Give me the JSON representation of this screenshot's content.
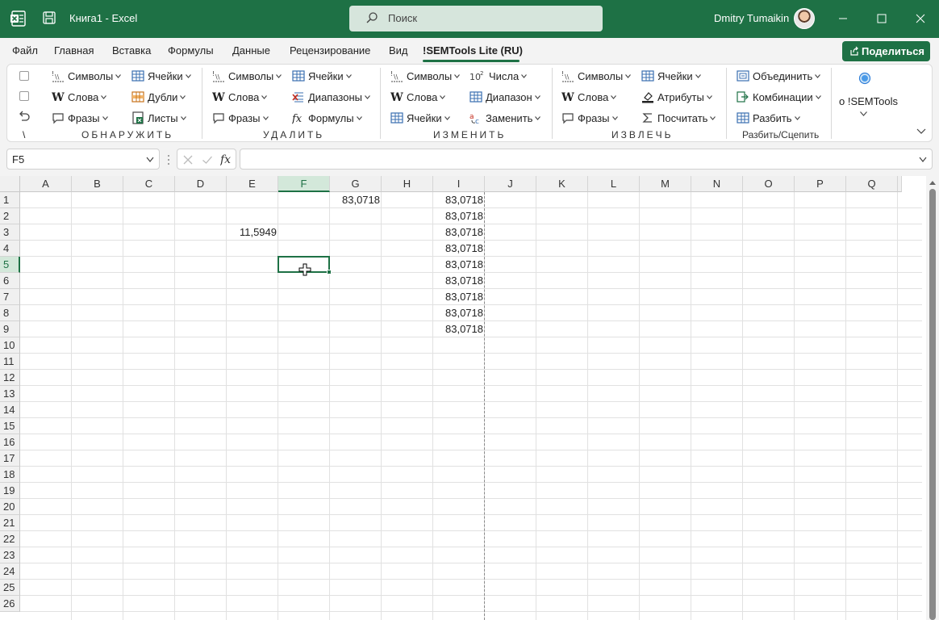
{
  "window": {
    "title": "Книга1  -  Excel",
    "search_placeholder": "Поиск",
    "user_name": "Dmitry Tumaikin"
  },
  "menu": {
    "tabs": [
      "Файл",
      "Главная",
      "Вставка",
      "Формулы",
      "Данные",
      "Рецензирование",
      "Вид",
      "!SEMTools Lite (RU)"
    ],
    "active_tab": "!SEMTools Lite (RU)",
    "share_label": "Поделиться"
  },
  "ribbon": {
    "g1": {
      "label": "ОБНАРУЖИТЬ",
      "b1": "Символы",
      "b2": "Слова",
      "b3": "Фразы",
      "b4": "Ячейки",
      "b5": "Дубли",
      "b6": "Листы",
      "mini": "\\"
    },
    "g2": {
      "label": "УДАЛИТЬ",
      "b1": "Символы",
      "b2": "Слова",
      "b3": "Фразы",
      "b4": "Ячейки",
      "b5": "Диапазоны",
      "b6": "Формулы"
    },
    "g3": {
      "label": "ИЗМЕНИТЬ",
      "b1": "Символы",
      "b2": "Слова",
      "b3": "Ячейки",
      "b4": "Числа",
      "b5": "Диапазон",
      "b6": "Заменить"
    },
    "g4": {
      "label": "ИЗВЛЕЧЬ",
      "b1": "Символы",
      "b2": "Слова",
      "b3": "Фразы",
      "b4": "Ячейки",
      "b5": "Атрибуты",
      "b6": "Посчитать"
    },
    "g5": {
      "label": "Разбить/Сцепить",
      "b1": "Объединить",
      "b2": "Комбинации",
      "b3": "Разбить"
    },
    "about": "о !SEMTools"
  },
  "formula_bar": {
    "name_box": "F5",
    "formula": ""
  },
  "sheet": {
    "columns": [
      "A",
      "B",
      "C",
      "D",
      "E",
      "F",
      "G",
      "H",
      "I",
      "J",
      "K",
      "L",
      "M",
      "N",
      "O",
      "P",
      "Q"
    ],
    "rows": [
      "1",
      "2",
      "3",
      "4",
      "5",
      "6",
      "7",
      "8",
      "9",
      "10",
      "11",
      "12",
      "13",
      "14",
      "15",
      "16",
      "17",
      "18",
      "19",
      "20",
      "21",
      "22",
      "23",
      "24",
      "25",
      "26"
    ],
    "selected_cell": "F5",
    "cells": {
      "G1": "83,0718",
      "E3": "11,5949",
      "I1": "83,0718",
      "I2": "83,0718",
      "I3": "83,0718",
      "I4": "83,0718",
      "I5": "83,0718",
      "I6": "83,0718",
      "I7": "83,0718",
      "I8": "83,0718",
      "I9": "83,0718"
    }
  },
  "colors": {
    "brand": "#1e7145",
    "selection_header": "#d3e8da"
  }
}
